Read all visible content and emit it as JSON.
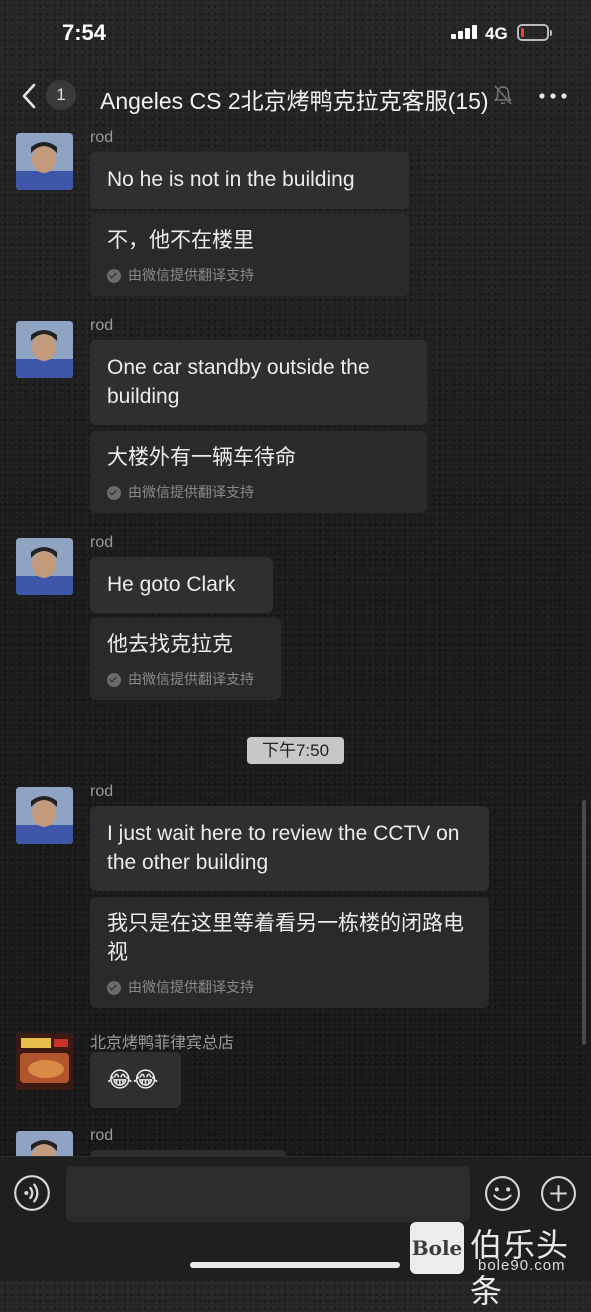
{
  "status_bar": {
    "time": "7:54",
    "network": "4G",
    "battery_level": 0.08,
    "battery_color": "#ff3b30"
  },
  "nav": {
    "back_icon": "chevron-left-icon",
    "unread_count": "1",
    "title": "Angeles CS 2北京烤鸭克拉克客服(15)",
    "mute_icon": "bell-slash-icon",
    "more_icon": "more-dots-icon"
  },
  "messages": [
    {
      "sender": "rod",
      "text": "No he is not in the building",
      "translation": "不，他不在楼里",
      "translation_note": "由微信提供翻译支持"
    },
    {
      "sender": "rod",
      "text": "One car standby outside the building",
      "translation": "大楼外有一辆车待命",
      "translation_note": "由微信提供翻译支持"
    },
    {
      "sender": "rod",
      "text": "He goto Clark",
      "translation": "他去找克拉克",
      "translation_note": "由微信提供翻译支持"
    },
    {
      "sender": "rod",
      "text": "I just wait here to review the CCTV on the other building",
      "translation": "我只是在这里等着看另一栋楼的闭路电视",
      "translation_note": "由微信提供翻译支持"
    },
    {
      "sender": "北京烤鸭菲律宾总店",
      "text": "😂😂"
    },
    {
      "sender": "rod"
    }
  ],
  "time_separator": "下午7:50",
  "input_bar": {
    "voice_icon": "voice-icon",
    "input_value": "",
    "emoji_icon": "emoji-smile-icon",
    "plus_icon": "plus-circle-icon"
  },
  "watermark": {
    "logo": "Bole",
    "name": "伯乐头条",
    "url": "bole90.com"
  }
}
